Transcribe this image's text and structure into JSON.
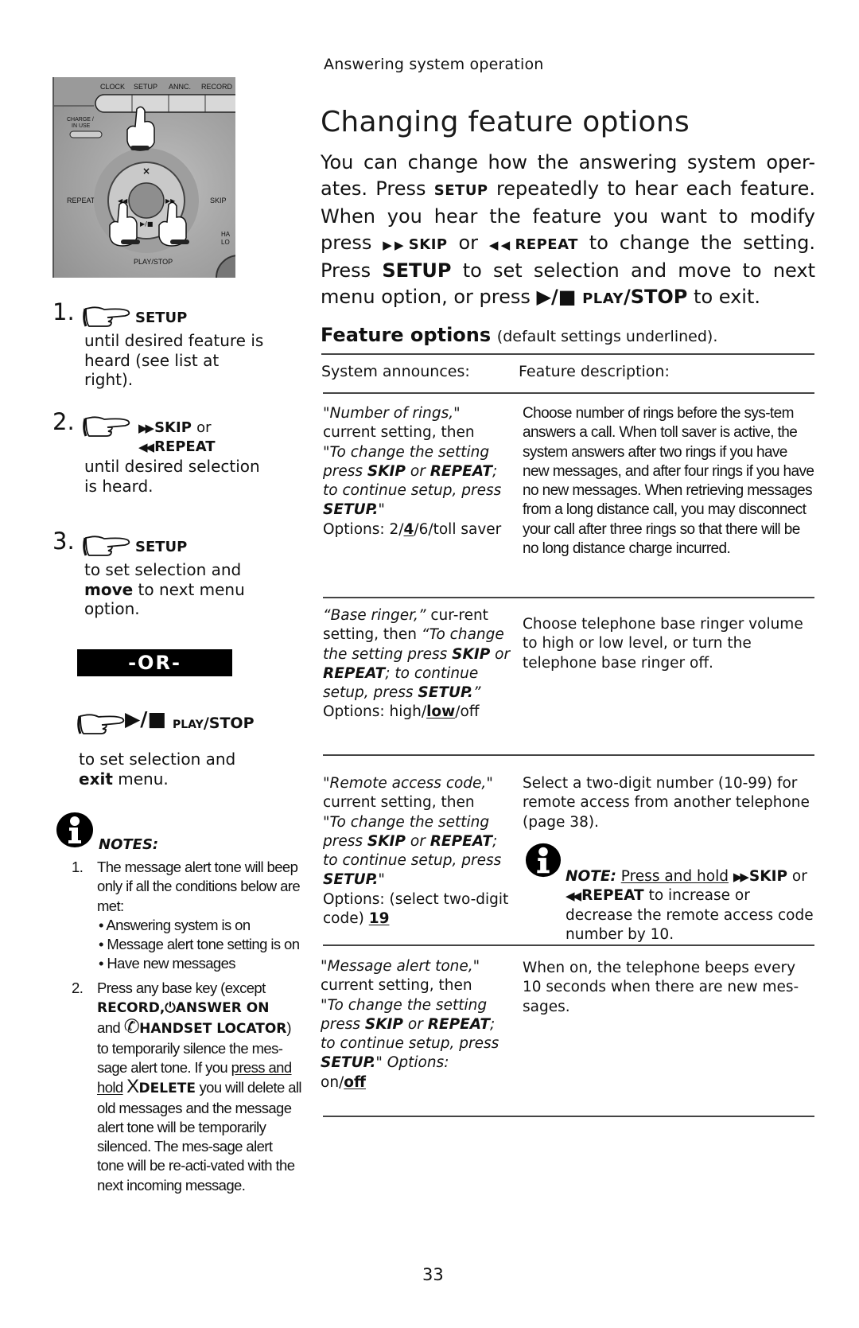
{
  "header": {
    "section": "Answering system operation",
    "title": "Changing feature options"
  },
  "intro": {
    "p1": "You can change how the answering system oper-ates. Press",
    "setup_key": "SETUP",
    "p2": "repeatedly to hear each feature. When you hear the feature you want to modify press",
    "skip_key": "SKIP",
    "or": "or",
    "repeat_key": "REPEAT",
    "p3": "to change the setting. Press",
    "setup_key2": "SETUP",
    "p4": "to set selection and move to next menu option, or press",
    "play_key_small": "PLAY",
    "play_key_big": "/STOP",
    "p5": "to exit."
  },
  "photo": {
    "labels": [
      "CLOCK",
      "SETUP",
      "ANNC.",
      "RECORD",
      "CHARGE / IN USE",
      "DELETE",
      "REPEAT",
      "SKIP",
      "PLAY/STOP",
      "HANDSET LOCATOR"
    ],
    "alt": "Base keypad with fingers pressing SETUP, REPEAT and SKIP"
  },
  "steps": [
    {
      "num": "1.",
      "key": "SETUP",
      "text": "until desired feature is heard (see list at right)."
    },
    {
      "num": "2.",
      "key": "SKIP",
      "key_or": "or",
      "key2": "REPEAT",
      "text": "until desired selection is heard."
    },
    {
      "num": "3.",
      "key": "SETUP",
      "text_pre": "to set selection and",
      "text_bold": "move",
      "text_post": "to next menu option."
    }
  ],
  "or_divider": "-OR-",
  "play_step": {
    "key_small": "PLAY",
    "key_big": "/STOP",
    "text_pre": "to set selection and",
    "text_bold": "exit",
    "text_post": "menu."
  },
  "notes": {
    "label": "NOTES:",
    "items": [
      {
        "num": "1.",
        "text": "The message alert tone will beep only if all the conditions below are met:",
        "bullets": [
          "Answering system is on",
          "Message alert tone setting is on",
          "Have new messages"
        ]
      },
      {
        "num": "2.",
        "text_pre": "Press any base key (except",
        "key1": "RECORD,",
        "key2": "ANSWER ON",
        "and": "and",
        "key3": "HANDSET LOCATOR",
        "close": ")",
        "text_mid": "to temporarily silence the mes-sage alert tone. If you",
        "underline": "press and hold",
        "delete_glyph": "X",
        "delete_key": "DELETE",
        "text_post": "you will delete all old messages and the message alert tone will be temporarily silenced. The mes-sage alert tone will be re-acti-vated with the next incoming message."
      }
    ]
  },
  "feature_options": {
    "heading": "Feature options",
    "subheading": "(default settings underlined).",
    "columns": [
      "System announces:",
      "Feature description:"
    ],
    "rows": [
      {
        "announce_quote": "\"Number of rings,\"",
        "announce_mid": "current setting, then",
        "prompt": [
          "\"To change the setting press ",
          "SKIP",
          " or ",
          "REPEAT",
          "; to continue setup, press ",
          "SETUP.",
          "\""
        ],
        "options_pre": "Options: 2/",
        "options_default": "4",
        "options_post": "/6/toll saver",
        "description": "Choose number of rings before the sys-tem answers a call. When toll saver is active, the system answers after two rings if you have new messages, and after four rings if you have no new messages. When retrieving messages from a long distance call, you may disconnect your call after three rings so that there will be no long distance charge incurred."
      },
      {
        "announce_quote": "“Base ringer,”",
        "announce_mid": "cur-rent setting, then",
        "prompt": [
          "“To change the setting press ",
          "SKIP",
          " or ",
          "REPEAT",
          "; to continue setup, press ",
          "SETUP.",
          "”"
        ],
        "options_pre": "Options: high/",
        "options_default": "low",
        "options_post": "/off",
        "description": "Choose telephone base ringer volume to high or low level, or turn the telephone base ringer off."
      },
      {
        "announce_quote": "\"Remote access code,\"",
        "announce_mid": "current setting, then",
        "prompt": [
          "\"To change the setting press ",
          "SKIP",
          " or ",
          "REPEAT",
          "; to continue setup, press ",
          "SETUP.",
          "\""
        ],
        "options_pre": "Options: (select two-digit code) ",
        "options_default": "19",
        "options_post": "",
        "description": "Select a two-digit number (10-99) for remote access from another telephone (page 38).",
        "note": {
          "label": "NOTE:",
          "underline": "Press and hold",
          "skip_key": "SKIP",
          "or": "or",
          "repeat_key": "REPEAT",
          "text": "to increase or decrease the remote access code number by 10."
        }
      },
      {
        "announce_quote": "\"Message alert tone,\"",
        "announce_mid": "current setting, then",
        "prompt": [
          "\"To change the setting press ",
          "SKIP",
          " or ",
          "REPEAT",
          "; to continue setup, press ",
          "SETUP.",
          "\" Options:"
        ],
        "options_pre": "on/",
        "options_default": "off",
        "options_post": "",
        "description": "When on, the telephone beeps every 10 seconds when there are new mes-sages."
      }
    ]
  },
  "page_number": "33"
}
